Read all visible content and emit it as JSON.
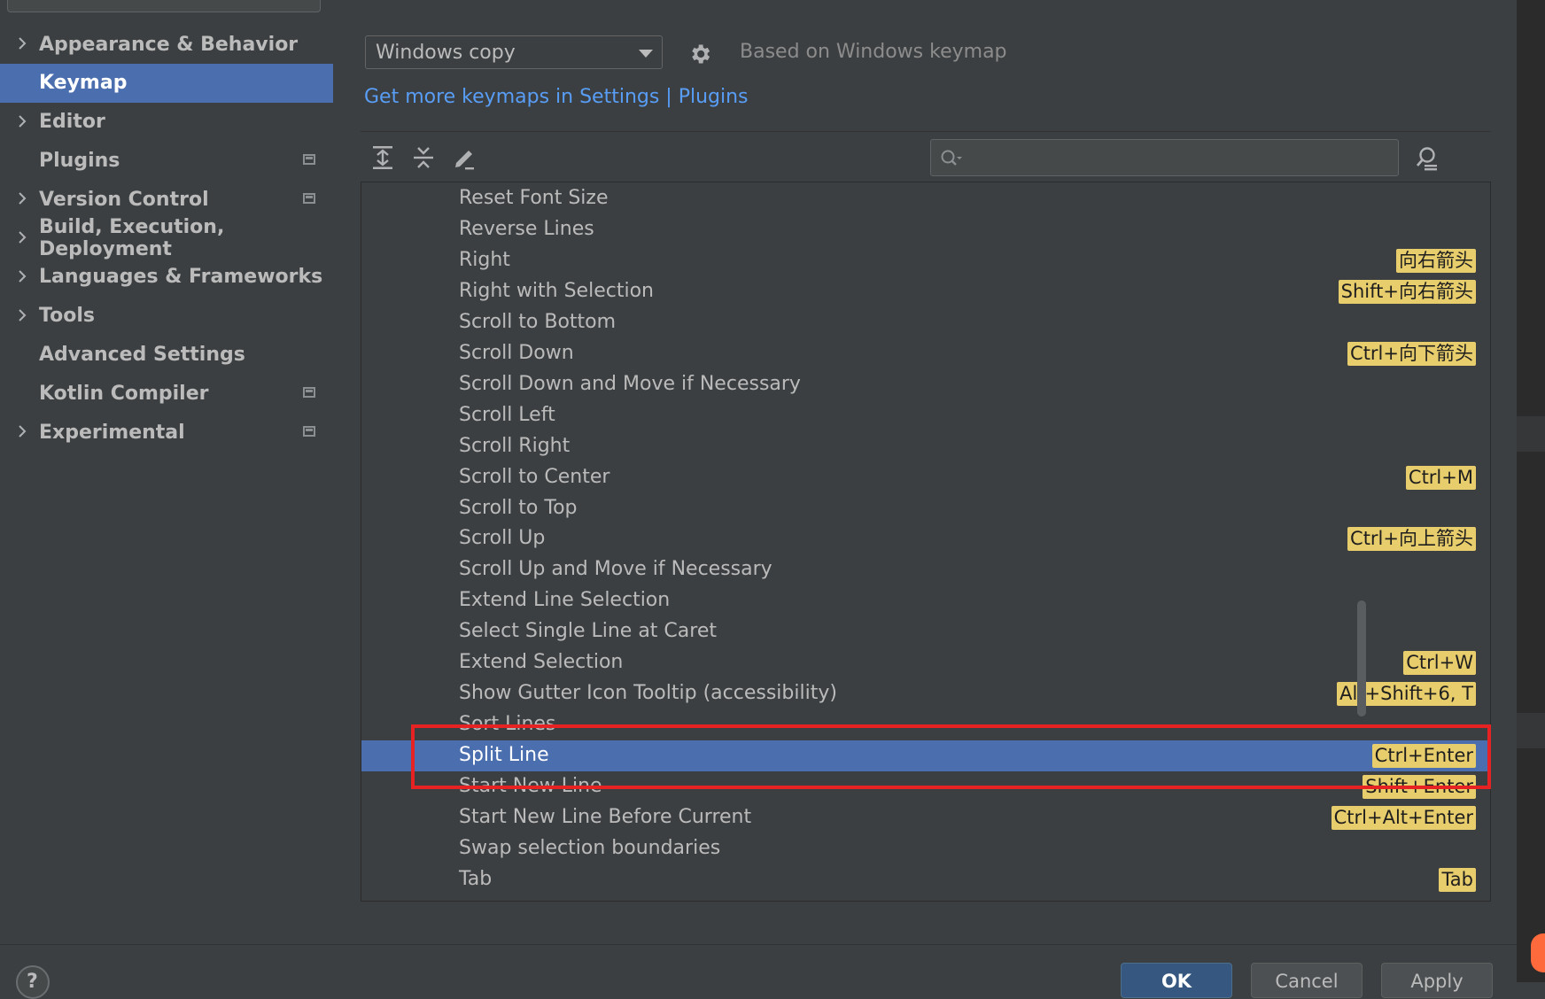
{
  "sidebar": {
    "items": [
      {
        "label": "Appearance & Behavior",
        "expandable": true,
        "project": false,
        "selected": false
      },
      {
        "label": "Keymap",
        "expandable": false,
        "project": false,
        "selected": true
      },
      {
        "label": "Editor",
        "expandable": true,
        "project": false,
        "selected": false
      },
      {
        "label": "Plugins",
        "expandable": false,
        "project": true,
        "selected": false
      },
      {
        "label": "Version Control",
        "expandable": true,
        "project": true,
        "selected": false
      },
      {
        "label": "Build, Execution, Deployment",
        "expandable": true,
        "project": false,
        "selected": false
      },
      {
        "label": "Languages & Frameworks",
        "expandable": true,
        "project": false,
        "selected": false
      },
      {
        "label": "Tools",
        "expandable": true,
        "project": false,
        "selected": false
      },
      {
        "label": "Advanced Settings",
        "expandable": false,
        "project": false,
        "selected": false
      },
      {
        "label": "Kotlin Compiler",
        "expandable": false,
        "project": true,
        "selected": false
      },
      {
        "label": "Experimental",
        "expandable": true,
        "project": true,
        "selected": false
      }
    ]
  },
  "keymap": {
    "scheme": "Windows copy",
    "based_on": "Based on Windows keymap",
    "link_text": "Get more keymaps in Settings | Plugins"
  },
  "toolbar": {
    "icons": [
      "expand-all-icon",
      "collapse-all-icon",
      "edit-icon"
    ],
    "search_placeholder": "",
    "find_shortcut_icon": "find-by-shortcut-icon"
  },
  "actions": [
    {
      "label": "Reset Font Size",
      "shortcut": ""
    },
    {
      "label": "Reverse Lines",
      "shortcut": ""
    },
    {
      "label": "Right",
      "shortcut": "向右箭头"
    },
    {
      "label": "Right with Selection",
      "shortcut": "Shift+向右箭头"
    },
    {
      "label": "Scroll to Bottom",
      "shortcut": ""
    },
    {
      "label": "Scroll Down",
      "shortcut": "Ctrl+向下箭头"
    },
    {
      "label": "Scroll Down and Move if Necessary",
      "shortcut": ""
    },
    {
      "label": "Scroll Left",
      "shortcut": ""
    },
    {
      "label": "Scroll Right",
      "shortcut": ""
    },
    {
      "label": "Scroll to Center",
      "shortcut": "Ctrl+M"
    },
    {
      "label": "Scroll to Top",
      "shortcut": ""
    },
    {
      "label": "Scroll Up",
      "shortcut": "Ctrl+向上箭头"
    },
    {
      "label": "Scroll Up and Move if Necessary",
      "shortcut": ""
    },
    {
      "label": "Extend Line Selection",
      "shortcut": ""
    },
    {
      "label": "Select Single Line at Caret",
      "shortcut": ""
    },
    {
      "label": "Extend Selection",
      "shortcut": "Ctrl+W"
    },
    {
      "label": "Show Gutter Icon Tooltip (accessibility)",
      "shortcut": "Alt+Shift+6, T"
    },
    {
      "label": "Sort Lines",
      "shortcut": ""
    },
    {
      "label": "Split Line",
      "shortcut": "Ctrl+Enter",
      "selected": true
    },
    {
      "label": "Start New Line",
      "shortcut": "Shift+Enter"
    },
    {
      "label": "Start New Line Before Current",
      "shortcut": "Ctrl+Alt+Enter"
    },
    {
      "label": "Swap selection boundaries",
      "shortcut": ""
    },
    {
      "label": "Tab",
      "shortcut": "Tab"
    }
  ],
  "buttons": {
    "help": "?",
    "ok": "OK",
    "cancel": "Cancel",
    "apply": "Apply"
  },
  "colors": {
    "background": "#3c3f41",
    "selection": "#4b6eaf",
    "shortcut_highlight": "#e8cd6c",
    "link": "#589df6",
    "annotation_red": "#e62222"
  }
}
